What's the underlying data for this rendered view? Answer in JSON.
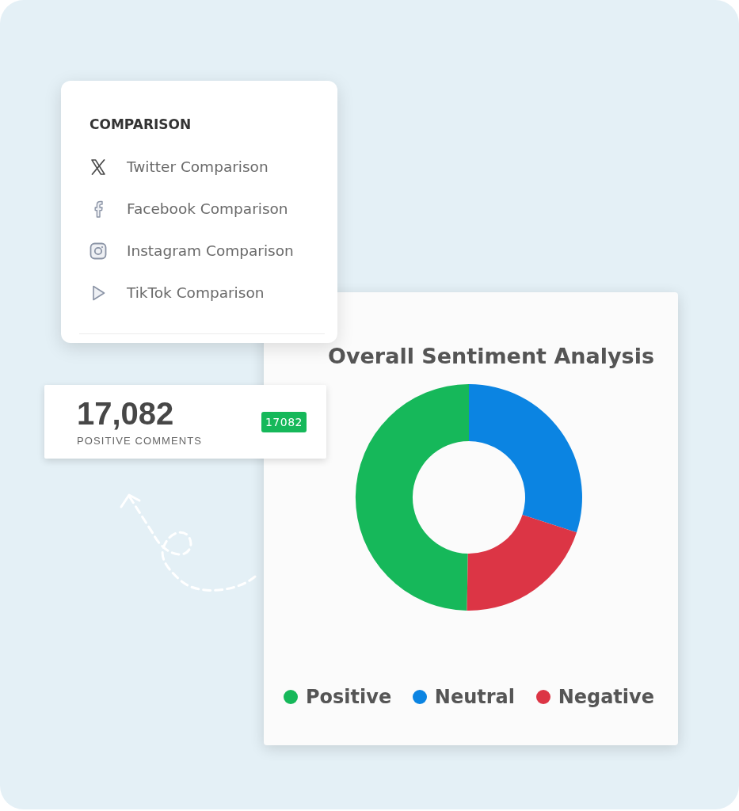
{
  "menu": {
    "title": "COMPARISON",
    "items": [
      {
        "label": "Twitter Comparison"
      },
      {
        "label": "Facebook Comparison"
      },
      {
        "label": "Instagram Comparison"
      },
      {
        "label": "TikTok Comparison"
      }
    ]
  },
  "stat_card": {
    "value": "17,082",
    "label": "POSITIVE COMMENTS",
    "badge": "17082"
  },
  "chart": {
    "title": "Overall Sentiment Analysis",
    "legend": [
      {
        "label": "Positive",
        "color": "#16b85a"
      },
      {
        "label": "Neutral",
        "color": "#0b84e2"
      },
      {
        "label": "Negative",
        "color": "#dc3545"
      }
    ]
  }
}
